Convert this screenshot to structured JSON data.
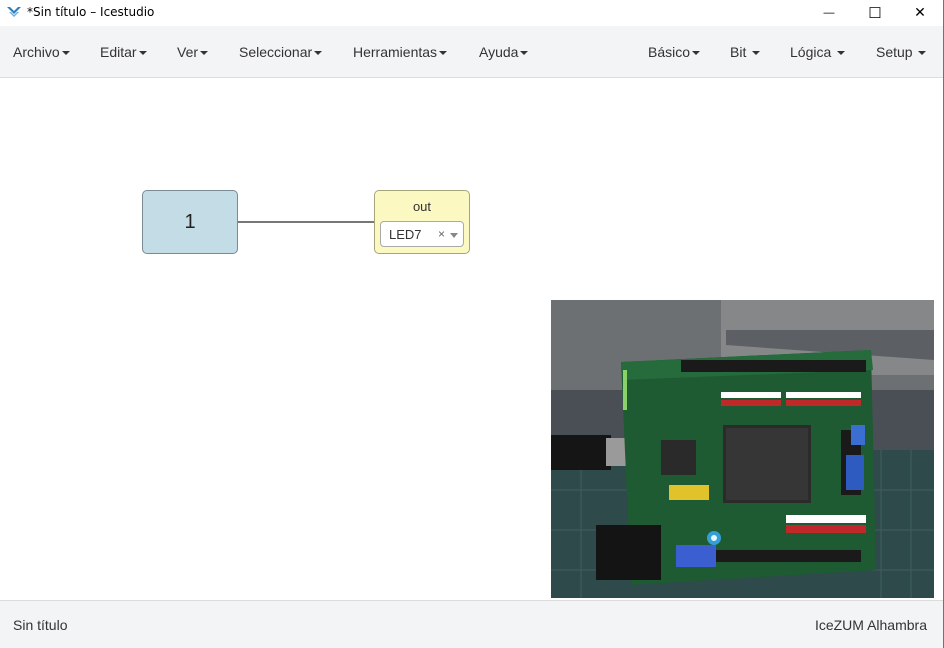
{
  "window": {
    "title": "*Sin título – Icestudio",
    "minimize_glyph": "—",
    "maximize_glyph": "☐",
    "close_glyph": "✕"
  },
  "menubar": {
    "left": [
      {
        "label": "Archivo"
      },
      {
        "label": "Editar"
      },
      {
        "label": "Ver"
      },
      {
        "label": "Seleccionar"
      },
      {
        "label": "Herramientas"
      },
      {
        "label": "Ayuda"
      }
    ],
    "right": [
      {
        "label": "Básico"
      },
      {
        "label": "Bit"
      },
      {
        "label": "Lógica"
      },
      {
        "label": "Setup"
      }
    ]
  },
  "canvas": {
    "constant_block": {
      "value": "1"
    },
    "output_block": {
      "label": "out",
      "pin": "LED7",
      "clear_glyph": "×"
    }
  },
  "statusbar": {
    "project_name": "Sin título",
    "board_name": "IceZUM Alhambra"
  },
  "colors": {
    "constant_block": "#c4dce6",
    "output_block": "#fbf8c2",
    "menubar_bg": "#f3f4f6"
  }
}
